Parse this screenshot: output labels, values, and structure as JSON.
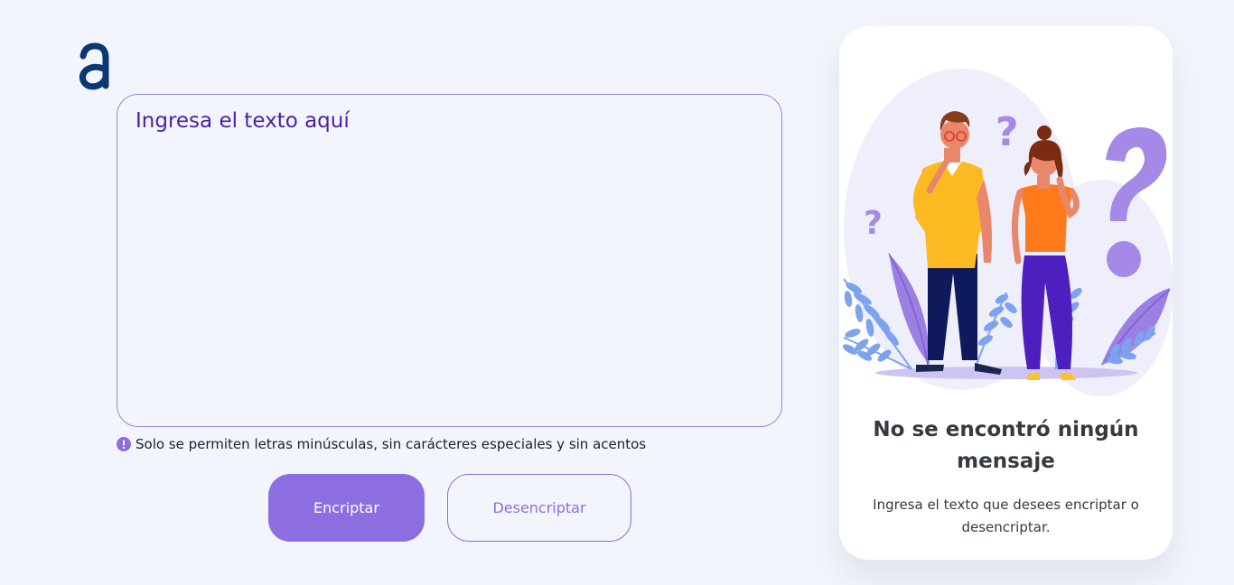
{
  "logo": {
    "icon": "alura-a-logo-icon",
    "color": "#0a3871"
  },
  "input": {
    "placeholder": "Ingresa el texto aquí",
    "value": ""
  },
  "hint": {
    "icon": "exclamation-circle-icon",
    "text": "Solo se permiten letras minúsculas, sin carácteres especiales y sin acentos"
  },
  "buttons": {
    "encrypt_label": "Encriptar",
    "decrypt_label": "Desencriptar"
  },
  "output": {
    "illustration": "confused-people-question-marks-illustration",
    "title": "No se encontró ningún mensaje",
    "description": "Ingresa el texto que desees encriptar o desencriptar."
  },
  "colors": {
    "background": "#f3f5fc",
    "accent": "#8d6ee0",
    "input_text": "#4a1fa8",
    "brand": "#0a3871"
  }
}
